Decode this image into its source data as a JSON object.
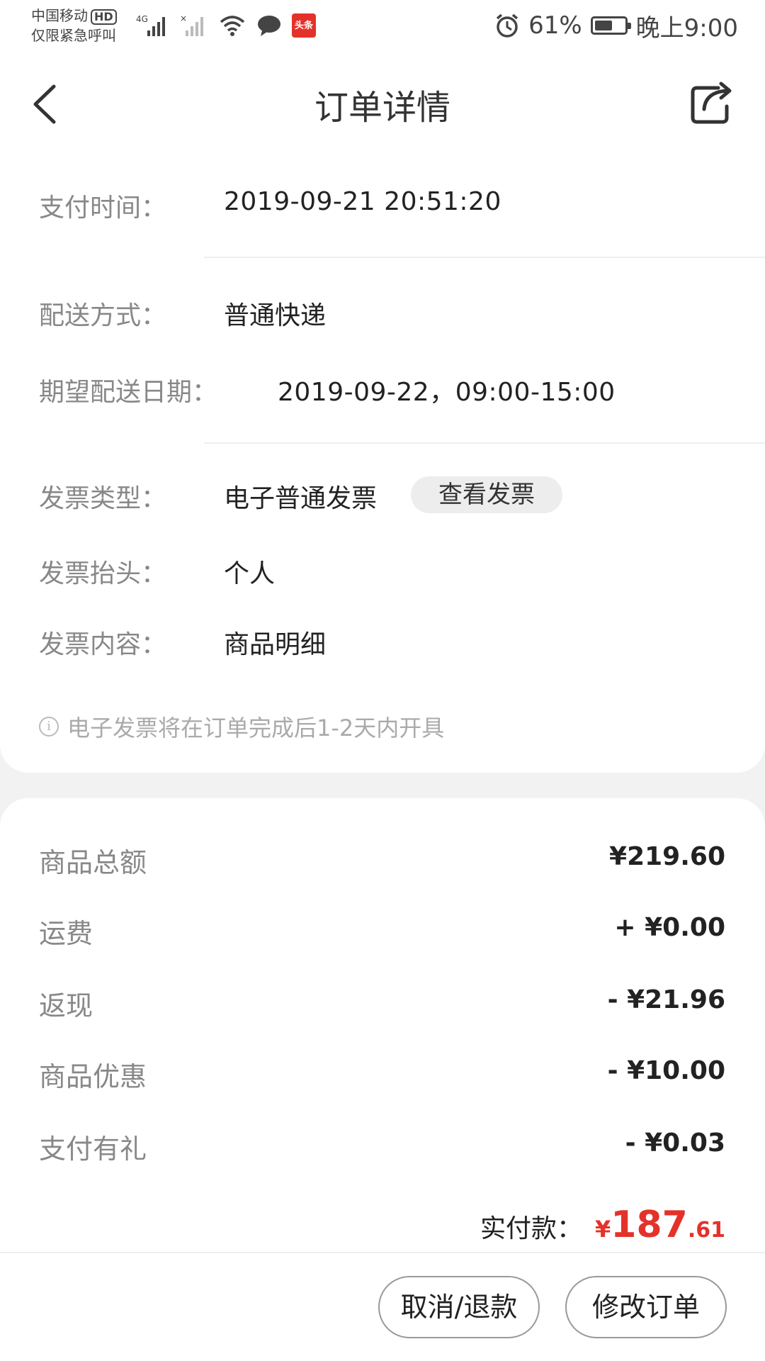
{
  "status_bar": {
    "carrier": "中国移动",
    "hd": "HD",
    "emergency": "仅限紧急呼叫",
    "network": "4G",
    "news_badge": "头条",
    "battery_text": "61%",
    "battery_level": 0.61,
    "time": "晚上9:00"
  },
  "header": {
    "title": "订单详情"
  },
  "details": {
    "pay_time": {
      "label": "支付时间：",
      "value": "2019-09-21 20:51:20"
    },
    "delivery_method": {
      "label": "配送方式：",
      "value": "普通快递"
    },
    "expected_date": {
      "label": "期望配送日期：",
      "value": "2019-09-22，09:00-15:00"
    },
    "invoice_type": {
      "label": "发票类型：",
      "value": "电子普通发票",
      "action": "查看发票"
    },
    "invoice_title": {
      "label": "发票抬头：",
      "value": "个人"
    },
    "invoice_content": {
      "label": "发票内容：",
      "value": "商品明细"
    },
    "note": "电子发票将在订单完成后1-2天内开具"
  },
  "summary": {
    "rows": [
      {
        "label": "商品总额",
        "value": "¥219.60"
      },
      {
        "label": "运费",
        "value": "+ ¥0.00"
      },
      {
        "label": "返现",
        "value": "- ¥21.96"
      },
      {
        "label": "商品优惠",
        "value": "- ¥10.00"
      },
      {
        "label": "支付有礼",
        "value": "- ¥0.03"
      }
    ],
    "total_label": "实付款：",
    "total_currency": "¥",
    "total_int": "187",
    "total_dec": ".61"
  },
  "actions": {
    "cancel": "取消/退款",
    "modify": "修改订单"
  },
  "colors": {
    "accent_red": "#e4322b"
  }
}
